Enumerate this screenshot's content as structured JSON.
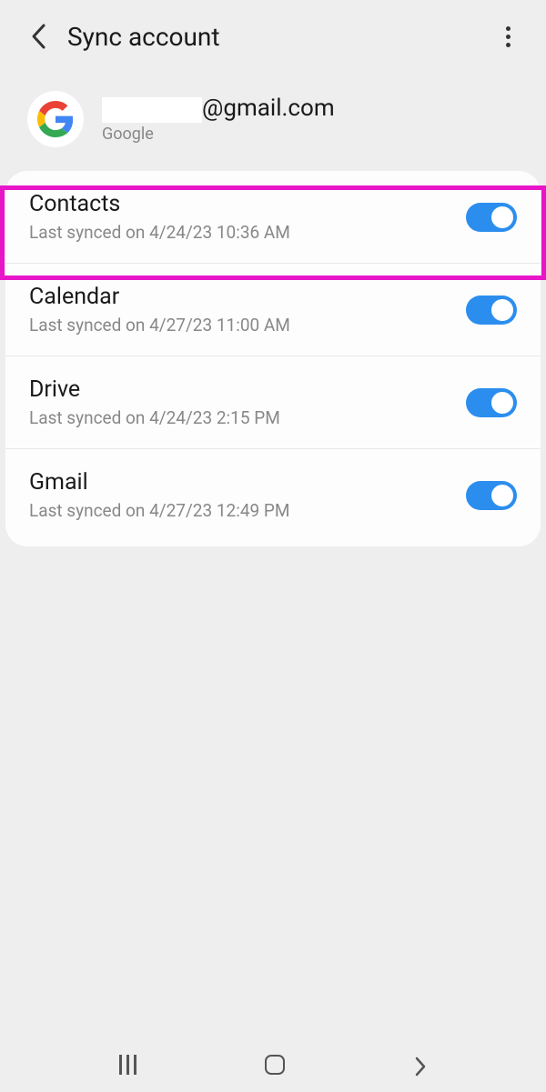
{
  "header": {
    "title": "Sync account"
  },
  "account": {
    "email_suffix": "@gmail.com",
    "provider": "Google"
  },
  "sync_items": [
    {
      "title": "Contacts",
      "subtitle": "Last synced on 4/24/23  10:36 AM",
      "enabled": true
    },
    {
      "title": "Calendar",
      "subtitle": "Last synced on 4/27/23  11:00 AM",
      "enabled": true
    },
    {
      "title": "Drive",
      "subtitle": "Last synced on 4/24/23  2:15 PM",
      "enabled": true
    },
    {
      "title": "Gmail",
      "subtitle": "Last synced on 4/27/23  12:49 PM",
      "enabled": true
    }
  ],
  "highlight_index": 0
}
